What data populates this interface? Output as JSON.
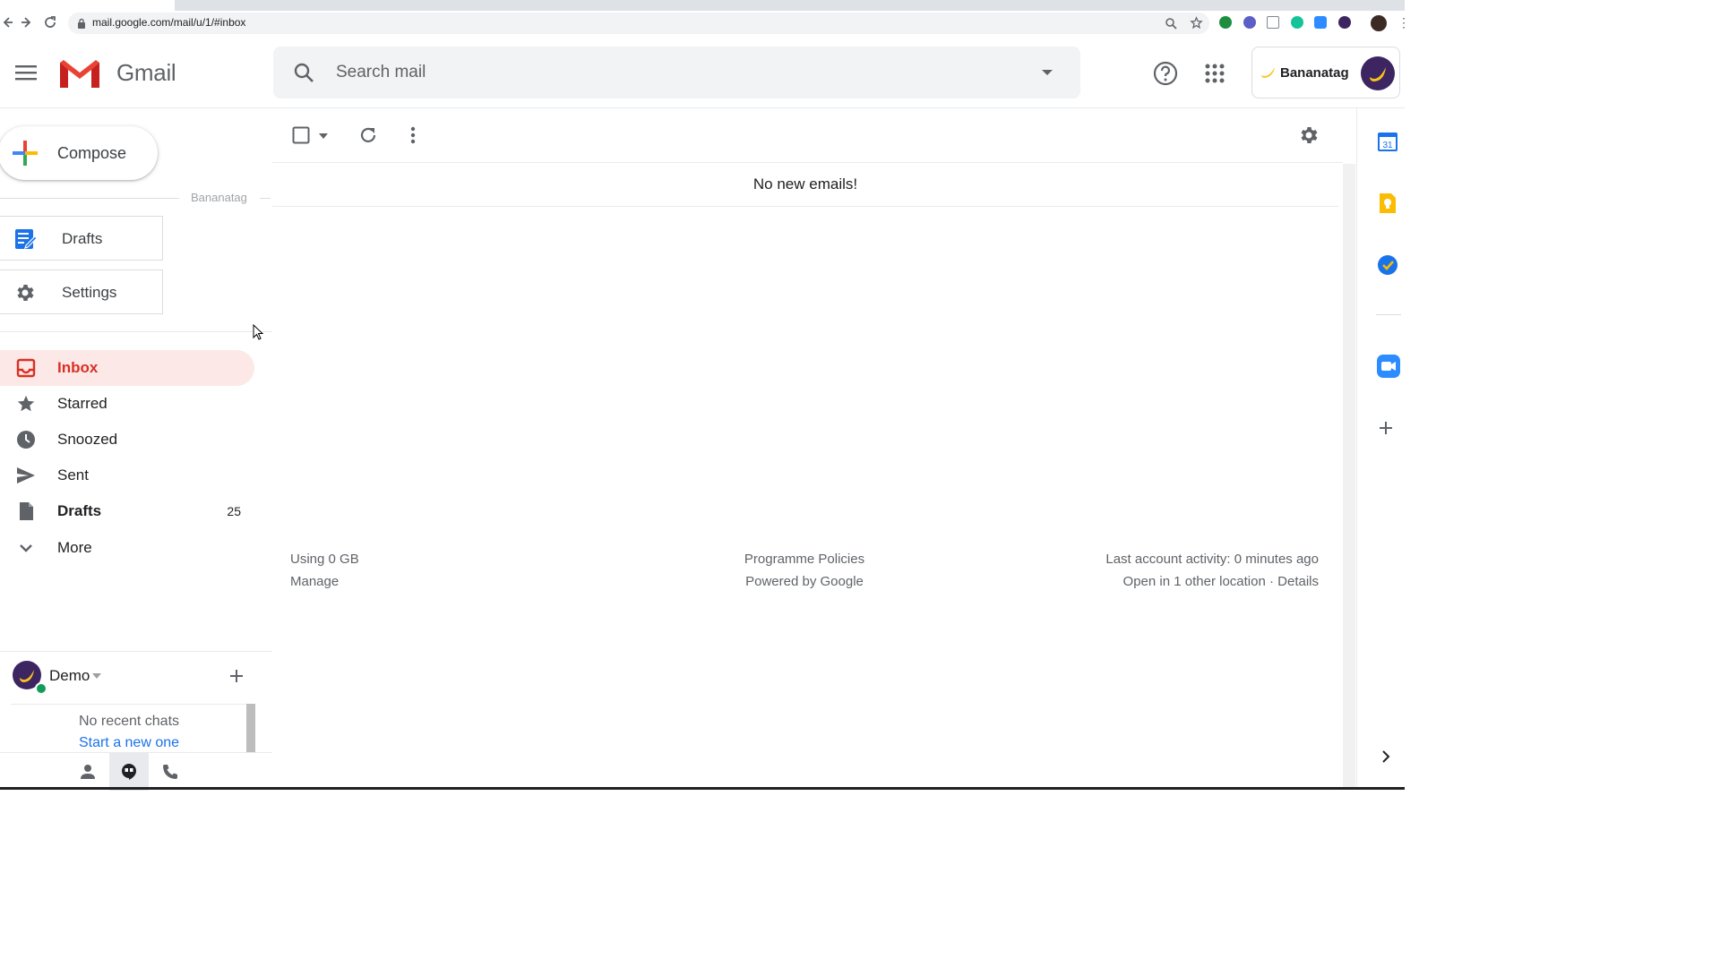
{
  "browser": {
    "url": "mail.google.com/mail/u/1/#inbox"
  },
  "header": {
    "app_name": "Gmail",
    "search_placeholder": "Search mail",
    "bananatag_label": "Bananatag"
  },
  "sidebar": {
    "compose_label": "Compose",
    "bananatag_section_label": "Bananatag",
    "bananatag_buttons": [
      {
        "label": "Drafts"
      },
      {
        "label": "Settings"
      }
    ],
    "nav_items": [
      {
        "label": "Inbox",
        "active": true,
        "icon": "inbox-icon"
      },
      {
        "label": "Starred",
        "icon": "star-icon"
      },
      {
        "label": "Snoozed",
        "icon": "clock-icon"
      },
      {
        "label": "Sent",
        "icon": "send-icon"
      },
      {
        "label": "Drafts",
        "count": "25",
        "icon": "draft-file-icon"
      },
      {
        "label": "More",
        "icon": "chevron-down-icon"
      }
    ]
  },
  "hangouts": {
    "user_name": "Demo",
    "no_chats_text": "No recent chats",
    "start_chat_link": "Start a new one"
  },
  "main": {
    "empty_message": "No new emails!",
    "footer": {
      "storage": "Using 0 GB",
      "manage": "Manage",
      "policies": "Programme Policies",
      "powered": "Powered by Google",
      "activity": "Last account activity: 0 minutes ago",
      "other_location": "Open in 1 other location · Details"
    }
  },
  "colors": {
    "active_nav_bg": "#fce8e6",
    "active_nav_text": "#d93025",
    "link": "#1a73e8",
    "bananatag_avatar": "#3d2562"
  }
}
